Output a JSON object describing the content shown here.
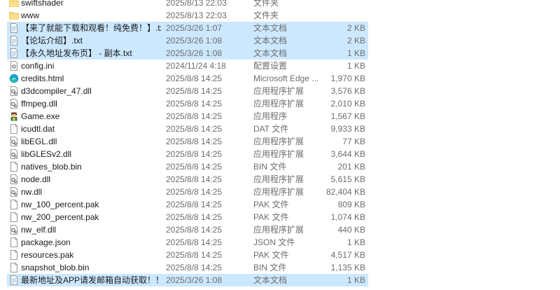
{
  "files": [
    {
      "name": "swiftshader",
      "date": "2025/8/13 22:03",
      "type": "文件夹",
      "size": "",
      "icon": "folder-icon",
      "selected": false
    },
    {
      "name": "www",
      "date": "2025/8/13 22:03",
      "type": "文件夹",
      "size": "",
      "icon": "folder-icon",
      "selected": false
    },
    {
      "name": "【来了就能下载和观看！纯免费！】.txt",
      "date": "2025/3/26 1:07",
      "type": "文本文档",
      "size": "2 KB",
      "icon": "text-file-icon",
      "selected": true
    },
    {
      "name": "【论坛介绍】.txt",
      "date": "2025/3/26 1:08",
      "type": "文本文档",
      "size": "2 KB",
      "icon": "text-file-icon",
      "selected": true
    },
    {
      "name": "【永久地址发布页】 - 副本.txt",
      "date": "2025/3/26 1:08",
      "type": "文本文档",
      "size": "1 KB",
      "icon": "text-file-icon",
      "selected": true
    },
    {
      "name": "config.ini",
      "date": "2024/11/24 4:18",
      "type": "配置设置",
      "size": "1 KB",
      "icon": "config-file-icon",
      "selected": false
    },
    {
      "name": "credits.html",
      "date": "2025/8/8 14:25",
      "type": "Microsoft Edge ...",
      "size": "1,970 KB",
      "icon": "edge-icon",
      "selected": false
    },
    {
      "name": "d3dcompiler_47.dll",
      "date": "2025/8/8 14:25",
      "type": "应用程序扩展",
      "size": "3,576 KB",
      "icon": "dll-file-icon",
      "selected": false
    },
    {
      "name": "ffmpeg.dll",
      "date": "2025/8/8 14:25",
      "type": "应用程序扩展",
      "size": "2,010 KB",
      "icon": "dll-file-icon",
      "selected": false
    },
    {
      "name": "Game.exe",
      "date": "2025/8/8 14:25",
      "type": "应用程序",
      "size": "1,567 KB",
      "icon": "game-exe-icon",
      "selected": false
    },
    {
      "name": "icudtl.dat",
      "date": "2025/8/8 14:25",
      "type": "DAT 文件",
      "size": "9,933 KB",
      "icon": "blank-file-icon",
      "selected": false
    },
    {
      "name": "libEGL.dll",
      "date": "2025/8/8 14:25",
      "type": "应用程序扩展",
      "size": "77 KB",
      "icon": "dll-file-icon",
      "selected": false
    },
    {
      "name": "libGLESv2.dll",
      "date": "2025/8/8 14:25",
      "type": "应用程序扩展",
      "size": "3,644 KB",
      "icon": "dll-file-icon",
      "selected": false
    },
    {
      "name": "natives_blob.bin",
      "date": "2025/8/8 14:25",
      "type": "BIN 文件",
      "size": "201 KB",
      "icon": "blank-file-icon",
      "selected": false
    },
    {
      "name": "node.dll",
      "date": "2025/8/8 14:25",
      "type": "应用程序扩展",
      "size": "5,615 KB",
      "icon": "dll-file-icon",
      "selected": false
    },
    {
      "name": "nw.dll",
      "date": "2025/8/8 14:25",
      "type": "应用程序扩展",
      "size": "82,404 KB",
      "icon": "dll-file-icon",
      "selected": false
    },
    {
      "name": "nw_100_percent.pak",
      "date": "2025/8/8 14:25",
      "type": "PAK 文件",
      "size": "809 KB",
      "icon": "blank-file-icon",
      "selected": false
    },
    {
      "name": "nw_200_percent.pak",
      "date": "2025/8/8 14:25",
      "type": "PAK 文件",
      "size": "1,074 KB",
      "icon": "blank-file-icon",
      "selected": false
    },
    {
      "name": "nw_elf.dll",
      "date": "2025/8/8 14:25",
      "type": "应用程序扩展",
      "size": "440 KB",
      "icon": "dll-file-icon",
      "selected": false
    },
    {
      "name": "package.json",
      "date": "2025/8/8 14:25",
      "type": "JSON 文件",
      "size": "1 KB",
      "icon": "blank-file-icon",
      "selected": false
    },
    {
      "name": "resources.pak",
      "date": "2025/8/8 14:25",
      "type": "PAK 文件",
      "size": "4,517 KB",
      "icon": "blank-file-icon",
      "selected": false
    },
    {
      "name": "snapshot_blob.bin",
      "date": "2025/8/8 14:25",
      "type": "BIN 文件",
      "size": "1,135 KB",
      "icon": "blank-file-icon",
      "selected": false
    },
    {
      "name": "最新地址及APP请发邮箱自动获取！！！",
      "date": "2025/3/26 1:08",
      "type": "文本文档",
      "size": "1 KB",
      "icon": "text-file-icon",
      "selected": true
    }
  ],
  "colors": {
    "selection": "#cce8ff",
    "folder": "#f8d775",
    "meta_text": "#6d6d6d",
    "edge": "#0f7bd4"
  }
}
